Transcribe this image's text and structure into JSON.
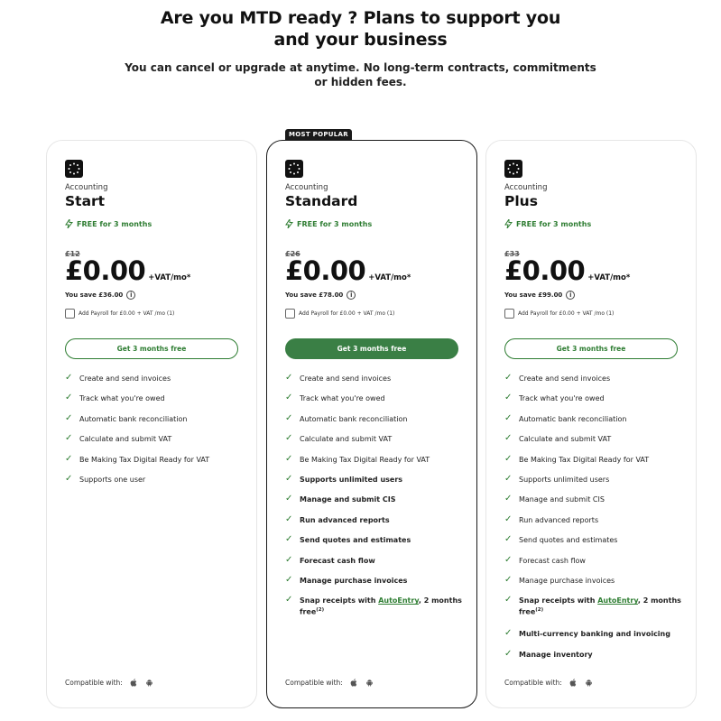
{
  "header": {
    "title_line1": "Are you MTD ready ? Plans to support you",
    "title_line2": "and your business",
    "subtitle_line1": "You can cancel or upgrade at anytime. No long-term contracts, commitments",
    "subtitle_line2": "or hidden fees."
  },
  "colors": {
    "accent": "#2e7d32",
    "cta_fill": "#3a7f45",
    "badge": "#1a1a1a"
  },
  "plans": [
    {
      "product": "Accounting",
      "name": "Start",
      "promo": "FREE for 3 months",
      "old_price": "£12",
      "price": "£0.00",
      "price_suffix": "+VAT/mo*",
      "save": "You save £36.00",
      "payroll": "Add Payroll for £0.00 + VAT /mo (1)",
      "cta": "Get 3 months free",
      "compatible": "Compatible with:",
      "features": [
        "Create and send invoices",
        "Track what you're owed",
        "Automatic bank reconciliation",
        "Calculate and submit VAT",
        "Be Making Tax Digital Ready for VAT",
        "Supports one user"
      ]
    },
    {
      "badge": "MOST POPULAR",
      "product": "Accounting",
      "name": "Standard",
      "promo": "FREE for 3 months",
      "old_price": "£26",
      "price": "£0.00",
      "price_suffix": "+VAT/mo*",
      "save": "You save £78.00",
      "payroll": "Add Payroll for £0.00 + VAT /mo (1)",
      "cta": "Get 3 months free",
      "compatible": "Compatible with:",
      "features": [
        "Create and send invoices",
        "Track what you're owed",
        "Automatic bank reconciliation",
        "Calculate and submit VAT",
        "Be Making Tax Digital Ready for VAT",
        "Supports unlimited users",
        "Manage and submit CIS",
        "Run advanced reports",
        "Send quotes and estimates",
        "Forecast cash flow",
        "Manage purchase invoices"
      ],
      "snap_pre": "Snap receipts with ",
      "snap_link": "AutoEntry",
      "snap_post": ", 2 months free",
      "snap_sup": "(2)"
    },
    {
      "product": "Accounting",
      "name": "Plus",
      "promo": "FREE for 3 months",
      "old_price": "£33",
      "price": "£0.00",
      "price_suffix": "+VAT/mo*",
      "save": "You save £99.00",
      "payroll": "Add Payroll for £0.00 + VAT /mo (1)",
      "cta": "Get 3 months free",
      "compatible": "Compatible with:",
      "features": [
        "Create and send invoices",
        "Track what you're owed",
        "Automatic bank reconciliation",
        "Calculate and submit VAT",
        "Be Making Tax Digital Ready for VAT",
        "Supports unlimited users",
        "Manage and submit CIS",
        "Run advanced reports",
        "Send quotes and estimates",
        "Forecast cash flow",
        "Manage purchase invoices"
      ],
      "snap_pre": "Snap receipts with ",
      "snap_link": "AutoEntry",
      "snap_post": ", 2 months free",
      "snap_sup": "(2)",
      "extra": [
        "Multi-currency banking and invoicing",
        "Manage inventory"
      ]
    }
  ]
}
